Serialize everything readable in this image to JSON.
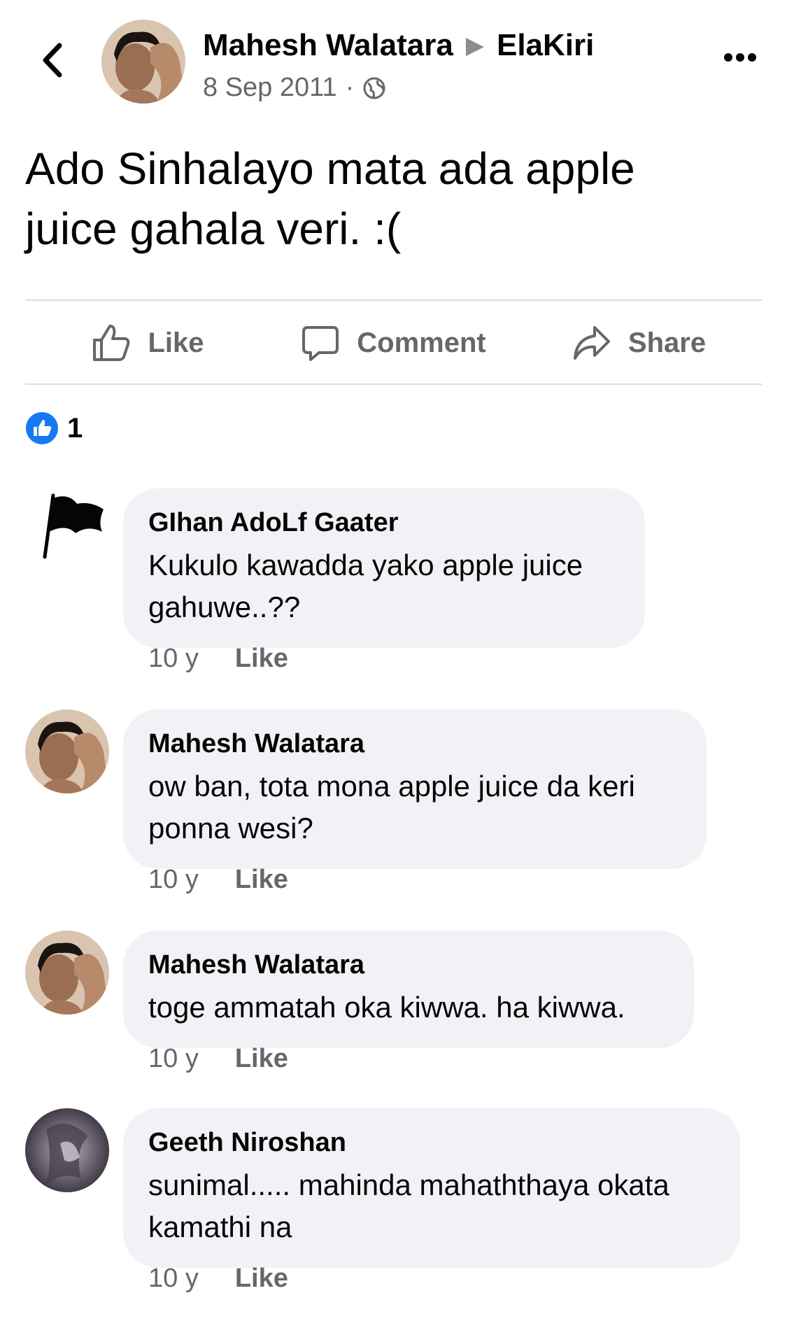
{
  "post": {
    "author": "Mahesh Walatara",
    "group": "ElaKiri",
    "date": "8 Sep 2011",
    "separator": "·",
    "text": "Ado Sinhalayo mata ada apple juice gahala veri. :(",
    "reaction_count": "1"
  },
  "actions": {
    "like": "Like",
    "comment": "Comment",
    "share": "Share"
  },
  "comments": [
    {
      "name": "GIhan AdoLf Gaater",
      "text": "Kukulo kawadda yako apple juice gahuwe..??",
      "time": "10 y",
      "like": "Like"
    },
    {
      "name": "Mahesh Walatara",
      "text": "ow ban, tota mona apple juice da keri ponna wesi?",
      "time": "10 y",
      "like": "Like"
    },
    {
      "name": "Mahesh Walatara",
      "text": "toge ammatah oka kiwwa. ha kiwwa.",
      "time": "10 y",
      "like": "Like"
    },
    {
      "name": "Geeth Niroshan",
      "text": "sunimal..... mahinda mahaththaya okata kamathi na",
      "time": "10 y",
      "like": "Like"
    }
  ],
  "icons": {
    "back": "chevron-left-icon",
    "more": "more-dots-icon",
    "globe": "globe-icon",
    "like": "thumbs-up-icon",
    "comment": "speech-bubble-icon",
    "share": "share-arrow-icon",
    "reaction": "like-reaction-icon",
    "flag": "flag-icon"
  },
  "colors": {
    "accent": "#1877f2",
    "secondary_text": "#65676b",
    "bubble": "#f0f2f5"
  }
}
